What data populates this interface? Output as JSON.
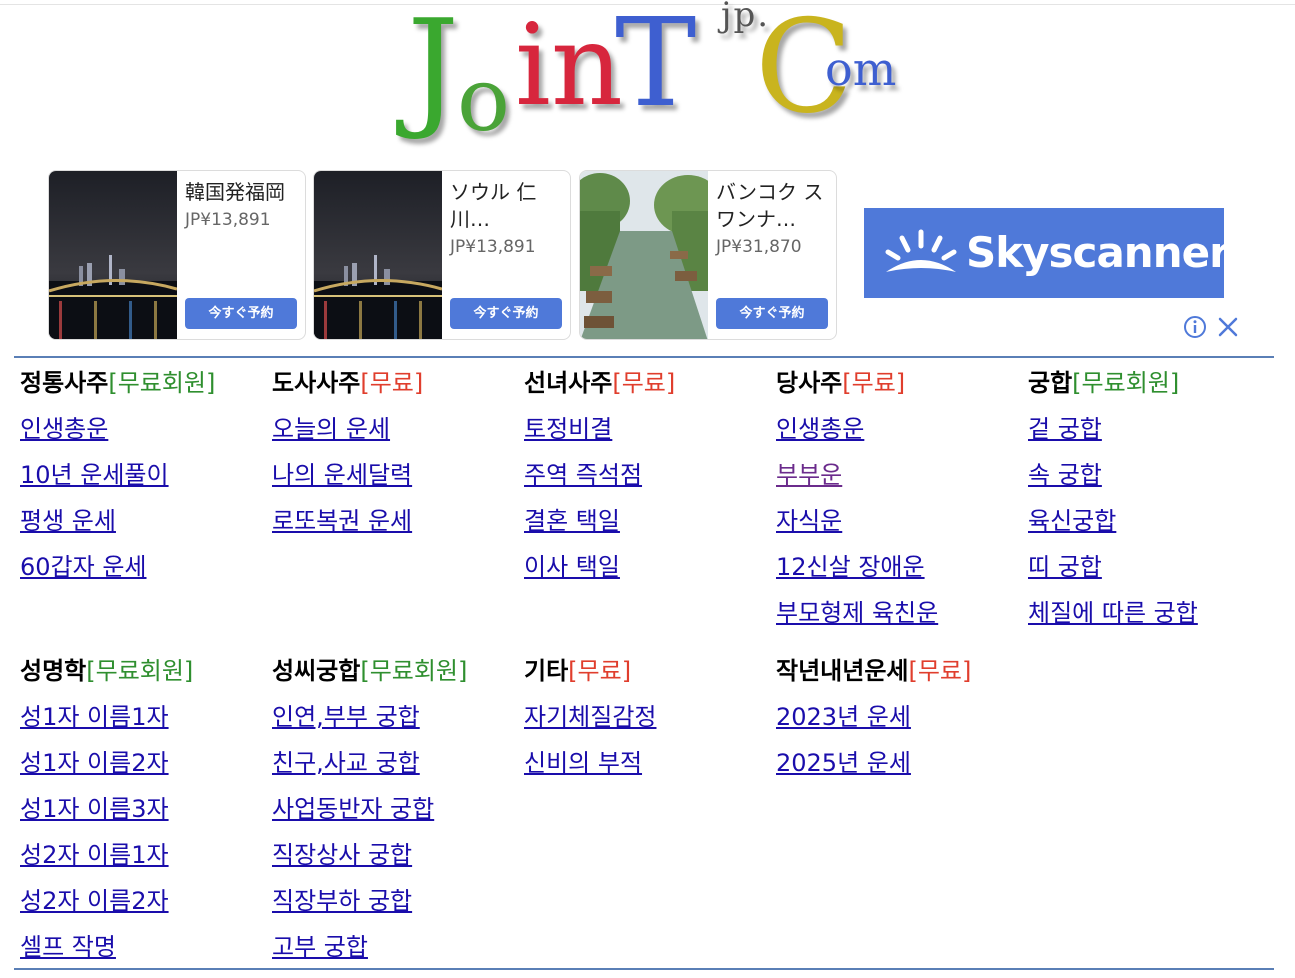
{
  "logo": {
    "J": "J",
    "o": "o",
    "in": "in",
    "T": "T",
    "jp": "jp.",
    "C": "C",
    "om": "om"
  },
  "ads": [
    {
      "title": "韓国発福岡",
      "price": "JP¥13,891",
      "button": "今すぐ予約"
    },
    {
      "title": "ソウル 仁川…",
      "price": "JP¥13,891",
      "button": "今すぐ予約"
    },
    {
      "title": "バンコク スワンナ…",
      "price": "JP¥31,870",
      "button": "今すぐ予約"
    }
  ],
  "skyscanner": {
    "label": "Skyscanner"
  },
  "menu": {
    "row1": [
      {
        "title": "정통사주",
        "tag": "[무료회원]",
        "tag_type": "member",
        "links": [
          "인생총운",
          "10년 운세풀이",
          "평생 운세",
          "60갑자 운세"
        ]
      },
      {
        "title": "도사사주",
        "tag": "[무료]",
        "tag_type": "free",
        "links": [
          "오늘의 운세",
          "나의 운세달력",
          "로또복권 운세"
        ]
      },
      {
        "title": "선녀사주",
        "tag": "[무료]",
        "tag_type": "free",
        "links": [
          "토정비결",
          "주역 즉석점",
          "결혼 택일",
          "이사 택일"
        ]
      },
      {
        "title": "당사주",
        "tag": "[무료]",
        "tag_type": "free",
        "links": [
          "인생총운",
          "부부운",
          "자식운",
          "12신살 장애운",
          "부모형제 육친운"
        ]
      },
      {
        "title": "궁합",
        "tag": "[무료회원]",
        "tag_type": "member",
        "links": [
          "겉 궁합",
          "속 궁합",
          "육신궁합",
          "띠 궁합",
          "체질에 따른 궁합"
        ]
      }
    ],
    "row2": [
      {
        "title": "성명학",
        "tag": "[무료회원]",
        "tag_type": "member",
        "links": [
          "성1자 이름1자",
          "성1자 이름2자",
          "성1자 이름3자",
          "성2자 이름1자",
          "성2자 이름2자",
          "셀프 작명"
        ]
      },
      {
        "title": "성씨궁합",
        "tag": "[무료회원]",
        "tag_type": "member",
        "links": [
          "인연,부부 궁합",
          "친구,사교 궁합",
          "사업동반자 궁합",
          "직장상사 궁합",
          "직장부하 궁합",
          "고부 궁합"
        ]
      },
      {
        "title": "기타",
        "tag": "[무료]",
        "tag_type": "free",
        "links": [
          "자기체질감정",
          "신비의 부적"
        ]
      },
      {
        "title": "작년내년운세",
        "tag": "[무료]",
        "tag_type": "free",
        "links": [
          "2023년 운세",
          "2025년 운세"
        ]
      }
    ]
  },
  "colors": {
    "link": "#1a0dab",
    "visited": "#6b2b8c",
    "free": "#e03e2d",
    "member": "#2f8f2f",
    "divider": "#5a7fb6",
    "ad_button": "#4f79d9"
  }
}
